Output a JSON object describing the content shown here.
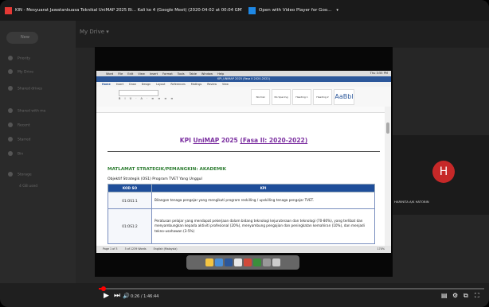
{
  "window": {
    "title": "KIN - Mesyuarat Jawatankuasa Teknikal UniMAP 2025 Bi... Kali ke 4 (Google Meet) (2020-04-02 at 00:04 GMT 7)",
    "open_with_label": "Open with Video Player for Goo...",
    "open_with_caret": "▾"
  },
  "drive": {
    "new_button": "New",
    "title": "My Drive ▾",
    "sidebar": [
      "Priority",
      "My Drive",
      "Shared drives",
      "Shared with me",
      "Recent",
      "Starred",
      "Bin",
      "Storage",
      "4 GB used"
    ]
  },
  "video": {
    "mac_menu": [
      "Word",
      "File",
      "Edit",
      "View",
      "Insert",
      "Format",
      "Tools",
      "Table",
      "Window",
      "Help"
    ],
    "mac_right": "Thu 3:55 PM",
    "word_title": "KPI_UNIMAP 2025 (Fasa II 2020-2022)",
    "ribbon_tabs": [
      "Home",
      "Insert",
      "Draw",
      "Design",
      "Layout",
      "References",
      "Mailings",
      "Review",
      "View"
    ],
    "ribbon_tools": "B I U · A · ≡ ≡ ≡ ≡",
    "styles": [
      "Normal",
      "No Spacing",
      "Heading 1",
      "Heading 2",
      "AaBbI"
    ],
    "doc_title_prefix": "KPI ",
    "doc_title_unimap": "UniMAP",
    "doc_title_suffix": " 2025 ",
    "doc_title_fasa": "(Fasa II: 2020-2022)",
    "strategic_heading": "MATLAMAT STRATEGIK/PEMANGKIN:   AKADEMIK",
    "objective": "Objektif Strategik   (OS1) Program TVET Yang Unggul",
    "table": {
      "headers": [
        "KOD SO",
        "KPI"
      ],
      "rows": [
        {
          "code": "01:OS1:1",
          "desc": "Bilangan tenaga pengajar yang mengikuti program reskilling / upskilling tenaga pengajar TVET."
        },
        {
          "code": "01:OS1:2",
          "desc": "Peratusan pelajar yang mendapat pekerjaan dalam bidang teknologi kejuruteraan dan teknologi (70-80%), yang terlibat dan menyambungkan kepada aktiviti profesional (20%), menyambung pengajian dan peningkatan kemahiran (10%), dan menjadi tekno-usahawan (3-5%)"
        }
      ]
    },
    "statusbar": [
      "Page 1 of 3",
      "5 of 1239 Words",
      "English (Malaysia)"
    ],
    "zoom": "170%"
  },
  "participant": {
    "initial": "H",
    "name": "HARINITA A/K HATOBIN"
  },
  "player": {
    "progress_fraction": 0.012,
    "time": "0:26 / 1:46:44",
    "play_icon": "▶",
    "next_icon": "⏭",
    "volume_icon": "🔊",
    "right_icons": [
      "▤",
      "⚙",
      "⧉",
      "⛶"
    ]
  },
  "colors": {
    "accent_red": "#ff0000",
    "word_blue": "#2b579a",
    "title_purple": "#7b2fa0",
    "heading_green": "#2e7d32",
    "table_header": "#1f4e9a"
  }
}
